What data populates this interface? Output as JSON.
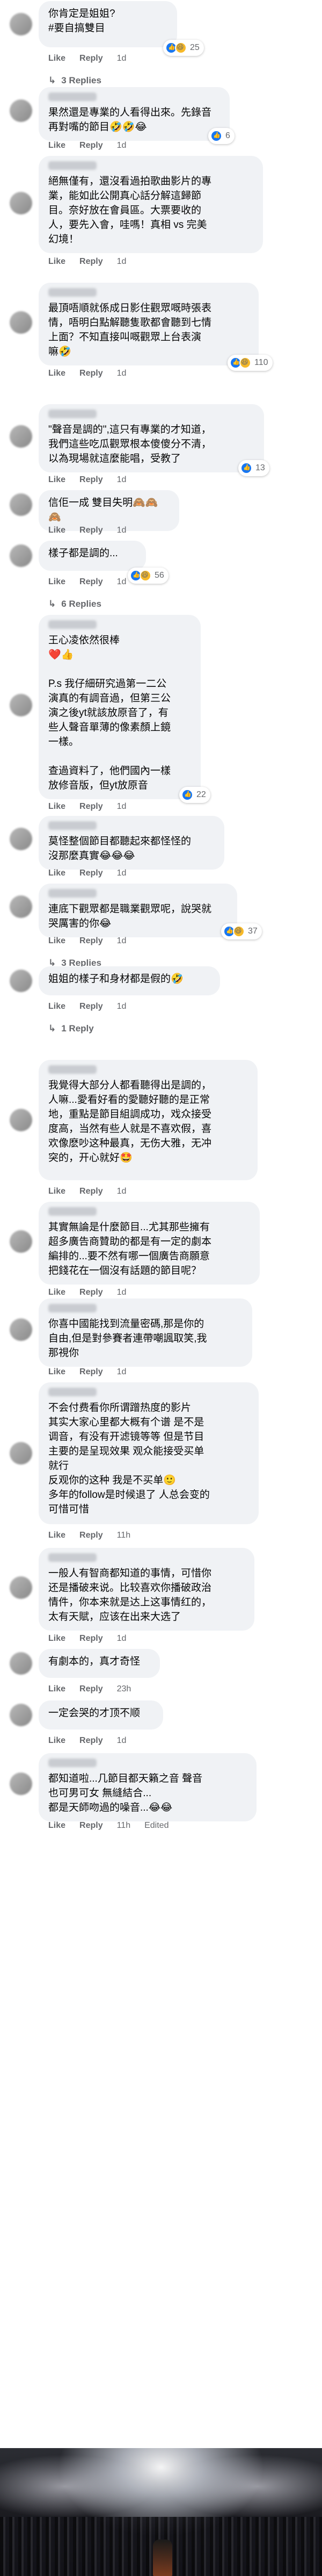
{
  "labels": {
    "like": "Like",
    "reply": "Reply",
    "edited": "Edited"
  },
  "comments": [
    {
      "text": "你肯定是姐姐?\n#要自搞雙目",
      "bold_second_line": true,
      "time": "1d",
      "reacts": [
        "like",
        "haha"
      ],
      "react_count": "25",
      "replies": "3 Replies"
    },
    {
      "text": "果然還是專業的人看得出來。先錄音\n再對嘴的節目🤣🤣😂",
      "time": "1d",
      "reacts": [
        "like"
      ],
      "react_count": "6",
      "replies": ""
    },
    {
      "text": "絕無僅有，還沒看過拍歌曲影片的專\n業，能如此公開真心話分解這歸節\n目。奈好放在會員區。大票要收的\n人，要先入會，哇嗎！真相 vs 完美\n幻境！",
      "time": "1d",
      "reacts": [],
      "react_count": "",
      "replies": ""
    },
    {
      "text": "最頂唔順就係成日影住觀眾嘅時張表\n情，唔明白點解聽隻歌都會聽到七情\n上面？不知直接叫嘅觀眾上台表演\n嘛🤣",
      "time": "1d",
      "reacts": [
        "like",
        "haha"
      ],
      "react_count": "110",
      "replies": ""
    },
    {
      "text": "\"聲音是調的\",這只有專業的才知道，\n我們這些吃瓜觀眾根本傻傻分不清，\n以為現場就這麼能唱，受教了",
      "time": "1d",
      "reacts": [
        "like"
      ],
      "react_count": "13",
      "replies": ""
    },
    {
      "text": "信佢一成 雙目失明🙈🙈🙈",
      "time": "1d",
      "reacts": [],
      "react_count": "",
      "replies": ""
    },
    {
      "text": "樣子都是調的...",
      "time": "1d",
      "reacts": [
        "like",
        "haha"
      ],
      "react_count": "56",
      "replies": "6 Replies"
    },
    {
      "text": "王心凌依然很棒\n❤️👍\n\nP.s 我仔細研究過第一二公\n演真的有調音過，但第三公\n演之後yt就該放原音了，有\n些人聲音單薄的像素顏上鏡\n一樣。\n\n查過資料了，他們國內一樣\n放修音版，但yt放原音",
      "time": "1d",
      "reacts": [
        "like"
      ],
      "react_count": "22",
      "replies": ""
    },
    {
      "text": "莫怪整個節目都聽起來都怪怪的\n沒那麼真實😂😂😂",
      "time": "1d",
      "reacts": [],
      "react_count": "",
      "replies": ""
    },
    {
      "text": "連底下觀眾都是職業觀眾呢，說哭就\n哭厲害的你😂",
      "time": "1d",
      "reacts": [
        "like",
        "haha"
      ],
      "react_count": "37",
      "replies": "3 Replies"
    },
    {
      "text": "姐姐的樣子和身材都是假的🤣",
      "time": "1d",
      "reacts": [],
      "react_count": "",
      "replies": "1 Reply"
    },
    {
      "text": "我覺得大部分人都看聽得出是調的，\n人嘛...愛看好看的愛聽好聽的是正常\n地，重點是節目組調成功，戏众接受\n度高，当然有些人就是不喜欢假，喜\n欢像麽吵这种最真，无伤大雅，无冲\n突的，开心就好🤩",
      "time": "1d",
      "reacts": [],
      "react_count": "",
      "replies": ""
    },
    {
      "text": "其實無論是什麼節目...尤其那些擁有\n超多廣告商贊助的都是有一定的劇本\n編排的...要不然有哪一個廣告商願意\n把錢花在一個沒有話題的節目呢？",
      "time": "1d",
      "reacts": [],
      "react_count": "",
      "replies": ""
    },
    {
      "text": "你喜中國能找到流量密碼,那是你的\n自由,但是對參賽者連帶嘲諷取笑,我\n那視你",
      "time": "1d",
      "reacts": [],
      "react_count": "",
      "replies": ""
    },
    {
      "text": "不会付费看你所谓蹭热度的影片\n其实大家心里都大概有个谱 是不是\n调音，有没有开滤镜等等 但是节目\n主要的是呈现效果 观众能接受买单\n就行\n反观你的这种 我是不买单🙂\n多年的follow是时候退了 人总会变的\n可惜可惜",
      "time": "11h",
      "reacts": [],
      "react_count": "",
      "replies": ""
    },
    {
      "text": "一般人有智商都知道的事情，可惜你\n还是播破来说。比较喜欢你播破政治\n情件，你本来就是达上这事情红的，\n太有天賦，应该在出来大选了",
      "time": "1d",
      "reacts": [],
      "react_count": "",
      "replies": ""
    },
    {
      "text": "有劇本的，真才奇怪",
      "time": "23h",
      "reacts": [],
      "react_count": "",
      "replies": ""
    },
    {
      "text": "一定会哭的才顶不顺",
      "time": "1d",
      "reacts": [],
      "react_count": "",
      "replies": ""
    },
    {
      "text": "都知道啦...几節目都天籟之音 聲音\n也可男可女 無縫結合...\n都是天師吻過的噪音...😂😂",
      "time": "11h",
      "edited": true,
      "reacts": [],
      "react_count": "",
      "replies": ""
    }
  ]
}
